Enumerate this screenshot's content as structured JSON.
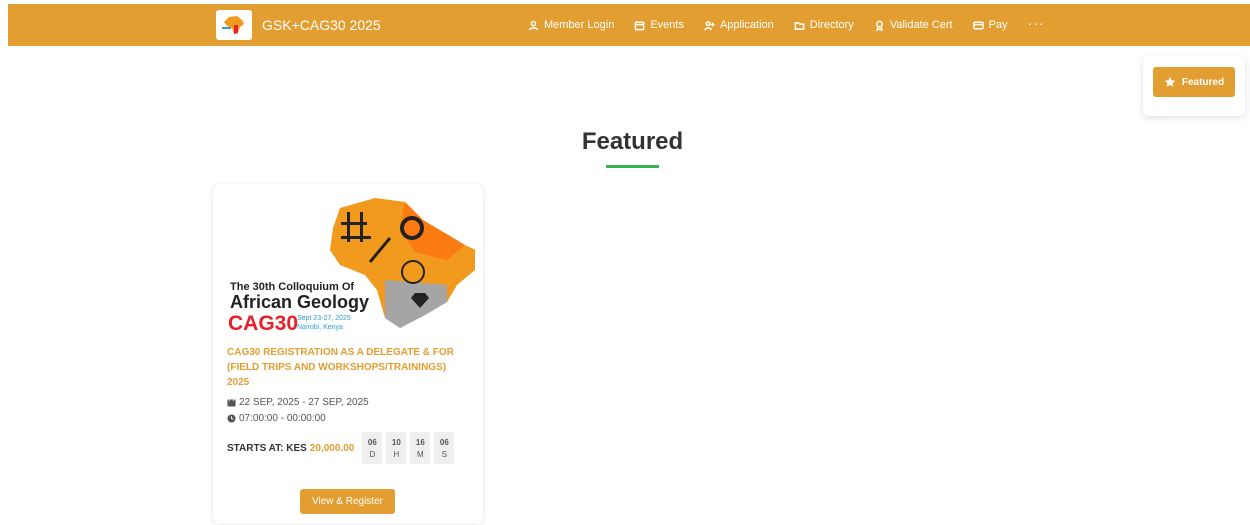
{
  "header": {
    "brand_title": "GSK+CAG30 2025",
    "menu": [
      {
        "label": "Member Login",
        "icon": "user-icon"
      },
      {
        "label": "Events",
        "icon": "calendar-icon"
      },
      {
        "label": "Application",
        "icon": "user-plus-icon"
      },
      {
        "label": "Directory",
        "icon": "folder-icon"
      },
      {
        "label": "Validate Cert",
        "icon": "award-icon"
      },
      {
        "label": "Pay",
        "icon": "credit-card-icon"
      }
    ],
    "more_label": "···"
  },
  "float_panel": {
    "button_label": "Featured",
    "icon": "star-icon"
  },
  "section": {
    "title": "Featured"
  },
  "event": {
    "poster": {
      "line1": "The 30th Colloquium Of",
      "line2": "African Geology",
      "line3": "CAG30",
      "dates": "Sept 23-27, 2025",
      "location": "Nairobi, Kenya"
    },
    "title": "CAG30 REGISTRATION AS A DELEGATE & FOR (FIELD TRIPS AND WORKSHOPS/TRAININGS) 2025",
    "date_range": "22 SEP, 2025 - 27 SEP, 2025",
    "time_range": "07:00:00 - 00:00:00",
    "price_label": "STARTS AT: KES",
    "price_value": "20,000.00",
    "countdown": [
      {
        "value": "06",
        "unit": "D"
      },
      {
        "value": "10",
        "unit": "H"
      },
      {
        "value": "16",
        "unit": "M"
      },
      {
        "value": "06",
        "unit": "S"
      }
    ],
    "register_label": "View & Register"
  },
  "colors": {
    "accent": "#e29e30",
    "underline": "#3bb34a",
    "poster_red": "#e8202a",
    "poster_blue": "#2a9fd8"
  }
}
